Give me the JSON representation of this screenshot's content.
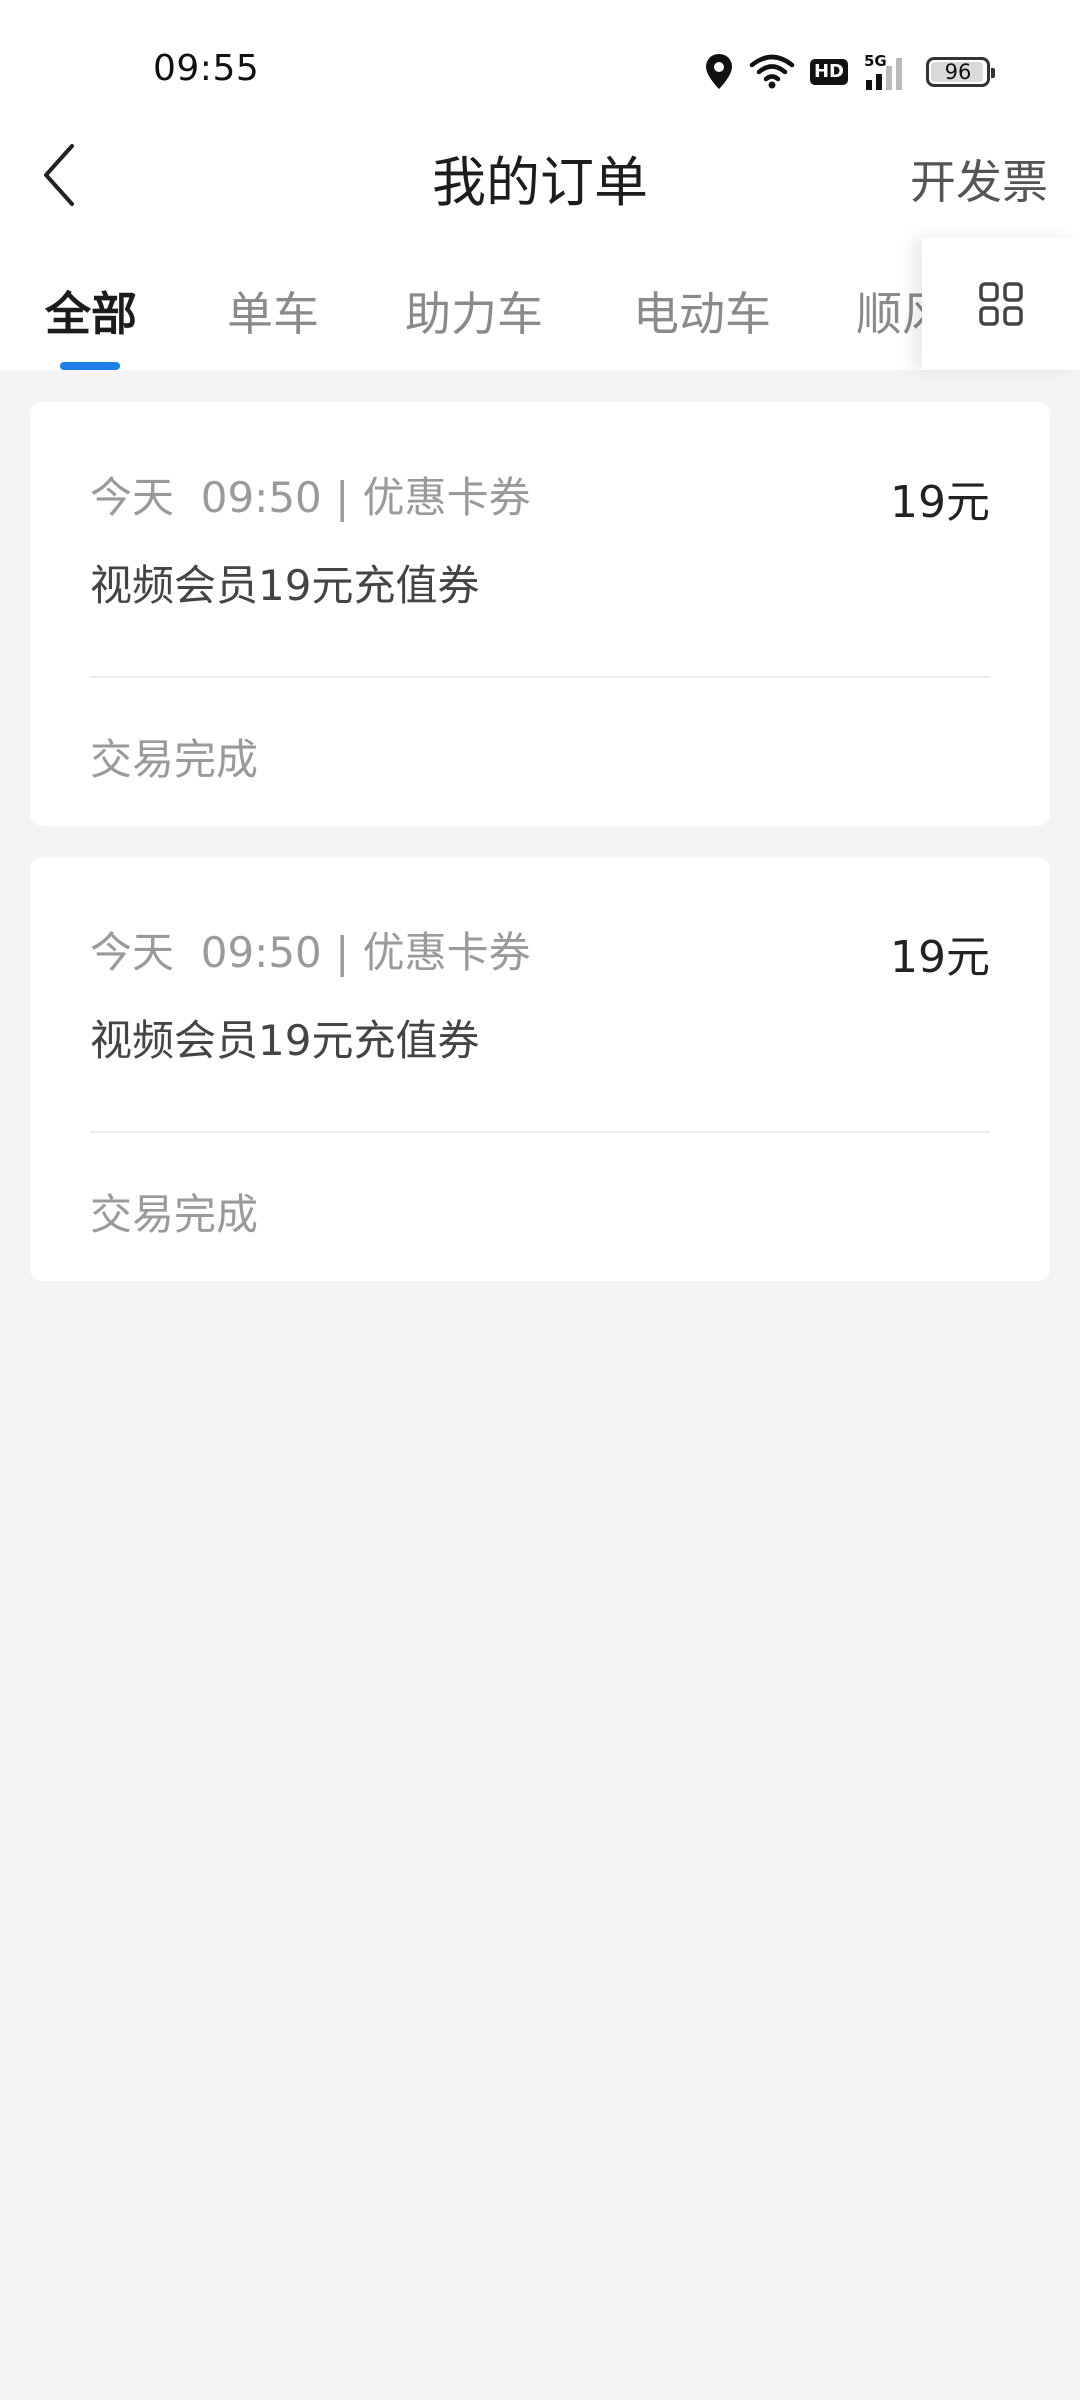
{
  "status_bar": {
    "time": "09:55",
    "icons": [
      "location-icon",
      "wifi-icon",
      "hd-icon",
      "signal-5g-icon",
      "battery-icon"
    ],
    "hd_label": "HD",
    "network_label": "5G",
    "battery_level": "96"
  },
  "header": {
    "title": "我的订单",
    "action_label": "开发票"
  },
  "tabs": [
    {
      "label": "全部",
      "active": true
    },
    {
      "label": "单车",
      "active": false
    },
    {
      "label": "助力车",
      "active": false
    },
    {
      "label": "电动车",
      "active": false
    },
    {
      "label": "顺风",
      "active": false
    }
  ],
  "orders": [
    {
      "date": "今天",
      "time": "09:50",
      "category": "优惠卡券",
      "amount": "19元",
      "name": "视频会员19元充值券",
      "status": "交易完成"
    },
    {
      "date": "今天",
      "time": "09:50",
      "category": "优惠卡券",
      "amount": "19元",
      "name": "视频会员19元充值券",
      "status": "交易完成"
    }
  ],
  "colors": {
    "accent": "#1f7ee8",
    "background": "#f4f4f4",
    "card": "#ffffff",
    "muted_text": "#9a9a9a"
  }
}
